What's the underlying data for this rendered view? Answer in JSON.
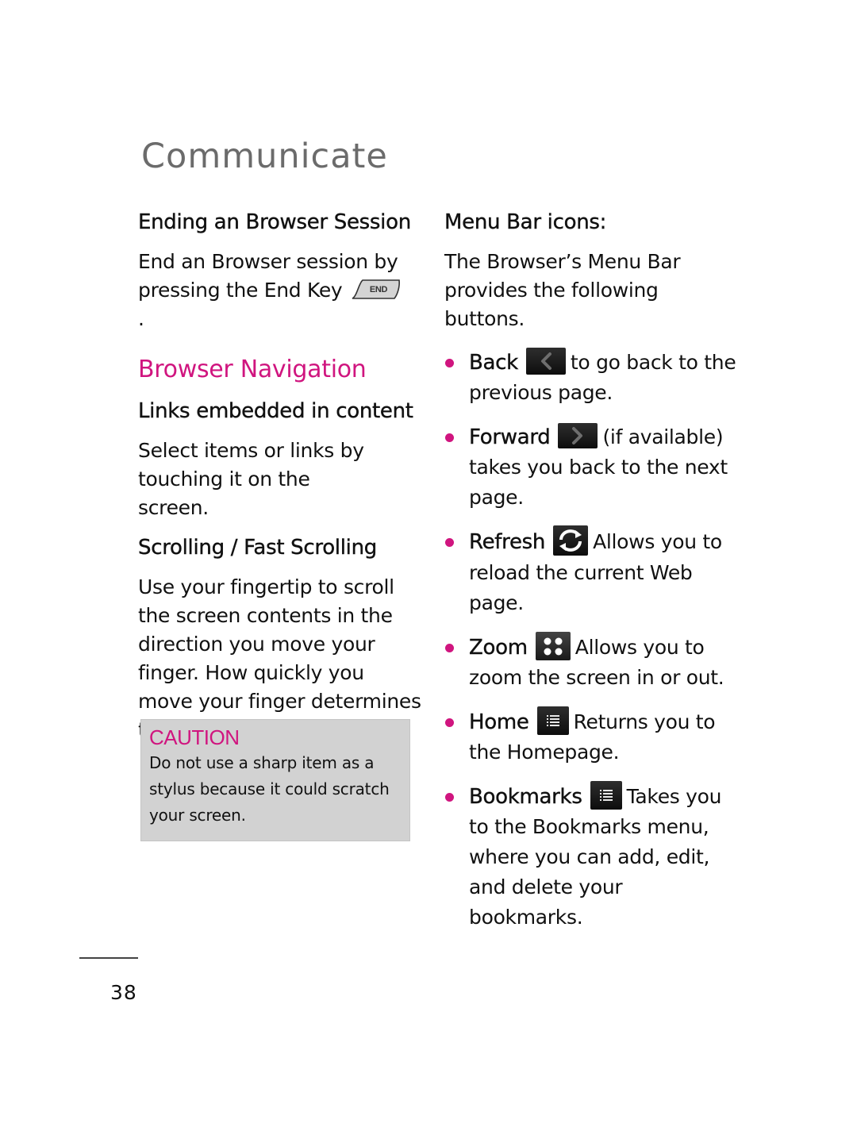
{
  "page": {
    "title": "Communicate",
    "page_number": "38",
    "accent_color": "#d0157f"
  },
  "left_column": {
    "ending_session": {
      "heading": "Ending an Browser Session",
      "text_before_key": "End an Browser session by pressing the End Key",
      "key_label": "END",
      "text_after_key": "."
    },
    "browser_navigation": {
      "heading": "Browser Navigation",
      "links": {
        "heading": "Links embedded in content",
        "text": "Select items or links by touching it on the screen."
      },
      "scrolling": {
        "heading": "Scrolling / Fast Scrolling",
        "text": "Use your fingertip to scroll the screen contents in the direction you move your finger. How quickly you move your finger determines the quickness of the scroll."
      }
    },
    "caution": {
      "title": "CAUTION",
      "text": "Do not use a sharp item as a stylus because it could scratch your screen."
    }
  },
  "right_column": {
    "heading": "Menu Bar icons:",
    "intro": "The Browser’s Menu Bar provides the following buttons.",
    "items": [
      {
        "label": "Back",
        "icon": "back-arrow-icon",
        "description": "to go back to the previous page."
      },
      {
        "label": "Forward",
        "icon": "forward-arrow-icon",
        "description": "(if available) takes you back to the next page."
      },
      {
        "label": "Refresh",
        "icon": "refresh-icon",
        "description": "Allows you to reload the current Web page."
      },
      {
        "label": "Zoom",
        "icon": "zoom-grid-icon",
        "description": "Allows you to zoom the screen in or out."
      },
      {
        "label": "Home",
        "icon": "home-list-icon",
        "description": "Returns you to the Homepage."
      },
      {
        "label": "Bookmarks",
        "icon": "bookmarks-list-icon",
        "description": "Takes you to the Bookmarks menu, where you can add, edit, and delete your bookmarks."
      }
    ]
  }
}
